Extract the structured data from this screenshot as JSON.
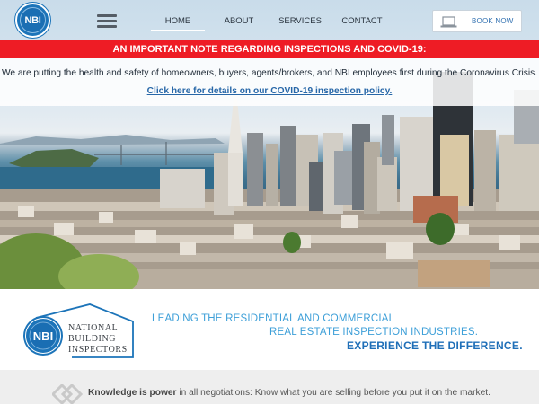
{
  "logo": {
    "text": "NBI"
  },
  "nav": {
    "items": [
      {
        "label": "HOME",
        "active": true
      },
      {
        "label": "ABOUT",
        "active": false
      },
      {
        "label": "SERVICES",
        "active": false
      },
      {
        "label": "CONTACT",
        "active": false
      }
    ],
    "book_now": "BOOK NOW"
  },
  "notice": {
    "headline": "AN IMPORTANT NOTE REGARDING INSPECTIONS AND COVID-19:",
    "message": "We are putting the health and safety of homeowners, buyers, agents/brokers, and NBI employees first during the Coronavirus Crisis.",
    "link": "Click here for details on our COVID-19 inspection policy."
  },
  "brand": {
    "logo_badge": "NBI",
    "logo_line1": "NATIONAL",
    "logo_line2": "BUILDING",
    "logo_line3": "INSPECTORS",
    "tagline_1": "LEADING THE RESIDENTIAL AND COMMERCIAL",
    "tagline_2": "REAL ESTATE INSPECTION INDUSTRIES.",
    "tagline_3": "EXPERIENCE THE DIFFERENCE."
  },
  "knowledge": {
    "strong": "Knowledge is power",
    "rest": " in all negotiations: Know what you are selling before you put it on the market."
  },
  "colors": {
    "brand_blue": "#1c74b9",
    "accent_red": "#ee1c25",
    "link_blue": "#2767a8",
    "tagline_light": "#3d9fd8"
  },
  "icons": [
    "hamburger-menu-icon",
    "laptop-icon",
    "diamond-chevron-icon",
    "house-outline-icon"
  ]
}
